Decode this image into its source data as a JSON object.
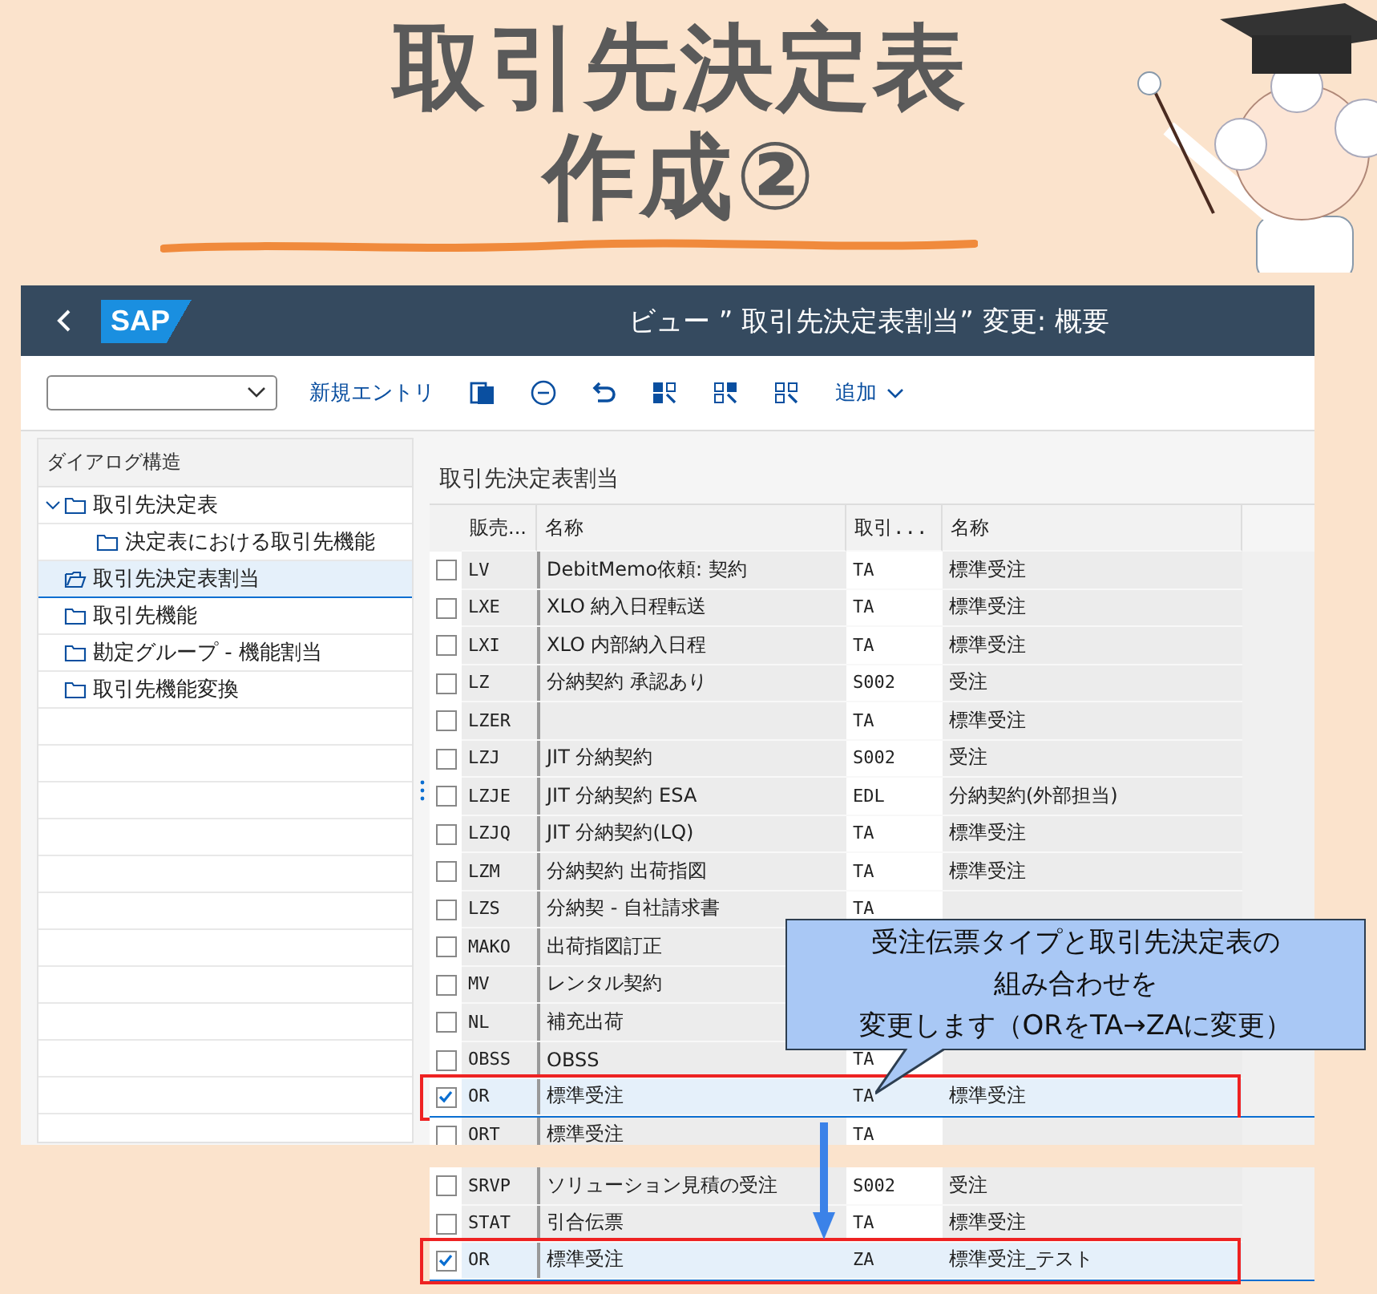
{
  "title_lines": [
    "取引先決定表",
    "作成②"
  ],
  "sap": {
    "logo": "SAP",
    "title": "ビュー ” 取引先決定表割当” 変更: 概要",
    "toolbar": {
      "new_entry": "新規エントリ",
      "add": "追加"
    },
    "sidebar": {
      "heading": "ダイアログ構造",
      "items": [
        {
          "label": "取引先決定表",
          "selected": false,
          "expanded": true,
          "children": [
            {
              "label": "決定表における取引先機能",
              "selected": false
            }
          ]
        },
        {
          "label": "取引先決定表割当",
          "selected": true
        },
        {
          "label": "取引先機能",
          "selected": false
        },
        {
          "label": "勘定グループ - 機能割当",
          "selected": false
        },
        {
          "label": "取引先機能変換",
          "selected": false
        }
      ]
    },
    "table": {
      "title": "取引先決定表割当",
      "columns": [
        "販売...",
        "名称",
        "取引...",
        "名称"
      ],
      "rows": [
        {
          "code": "LV",
          "name": "DebitMemo依頼: 契約",
          "proc": "TA",
          "proc_name": "標準受注",
          "checked": false,
          "selected": false,
          "marked": false
        },
        {
          "code": "LXE",
          "name": "XLO 納入日程転送",
          "proc": "TA",
          "proc_name": "標準受注",
          "checked": false,
          "selected": false,
          "marked": false
        },
        {
          "code": "LXI",
          "name": "XLO 内部納入日程",
          "proc": "TA",
          "proc_name": "標準受注",
          "checked": false,
          "selected": false,
          "marked": false
        },
        {
          "code": "LZ",
          "name": "分納契約 承認あり",
          "proc": "S002",
          "proc_name": "受注",
          "checked": false,
          "selected": false,
          "marked": false
        },
        {
          "code": "LZER",
          "proc": "TA",
          "proc_name": "標準受注",
          "checked": false,
          "selected": false,
          "marked": false
        },
        {
          "code": "LZJ",
          "name": "JIT 分納契約",
          "proc": "S002",
          "proc_name": "受注",
          "checked": false,
          "selected": false,
          "marked": false
        },
        {
          "code": "LZJE",
          "name": "JIT 分納契約 ESA",
          "proc": "EDL",
          "proc_name": "分納契約(外部担当)",
          "checked": false,
          "selected": false,
          "marked": false
        },
        {
          "code": "LZJQ",
          "name": "JIT 分納契約(LQ)",
          "proc": "TA",
          "proc_name": "標準受注",
          "checked": false,
          "selected": false,
          "marked": false
        },
        {
          "code": "LZM",
          "name": "分納契約 出荷指図",
          "proc": "TA",
          "proc_name": "標準受注",
          "checked": false,
          "selected": false,
          "marked": false
        },
        {
          "code": "LZS",
          "name": "分納契 - 自社請求書",
          "proc": "TA",
          "checked": false,
          "selected": false,
          "marked": false
        },
        {
          "code": "MAKO",
          "name": "出荷指図訂正",
          "checked": false,
          "selected": false,
          "marked": false
        },
        {
          "code": "MV",
          "name": "レンタル契約",
          "checked": false,
          "selected": false,
          "marked": false
        },
        {
          "code": "NL",
          "name": "補充出荷",
          "checked": false,
          "selected": false,
          "marked": false
        },
        {
          "code": "OBSS",
          "name": "OBSS",
          "proc": "TA",
          "checked": false,
          "selected": false,
          "marked": false
        },
        {
          "code": "OR",
          "name": "標準受注",
          "proc": "TA",
          "proc_name": "標準受注",
          "checked": true,
          "selected": true,
          "marked": true
        },
        {
          "code": "ORT",
          "name": "標準受注",
          "proc": "TA",
          "checked": false,
          "selected": false,
          "marked": false
        }
      ]
    }
  },
  "fragment_rows": [
    {
      "code": "SRVP",
      "name": "ソリューション見積の受注",
      "proc": "S002",
      "proc_name": "受注",
      "checked": false,
      "selected": false,
      "marked": false
    },
    {
      "code": "STAT",
      "name": "引合伝票",
      "proc": "TA",
      "proc_name": "標準受注",
      "checked": false,
      "selected": false,
      "marked": false
    },
    {
      "code": "OR",
      "name": "標準受注",
      "proc": "ZA",
      "proc_name": "標準受注_テスト",
      "checked": true,
      "selected": true,
      "marked": true
    }
  ],
  "callout": {
    "lines": [
      "受注伝票タイプと取引先決定表の",
      "組み合わせを",
      "変更します（ORをTA→ZAに変更）"
    ]
  }
}
